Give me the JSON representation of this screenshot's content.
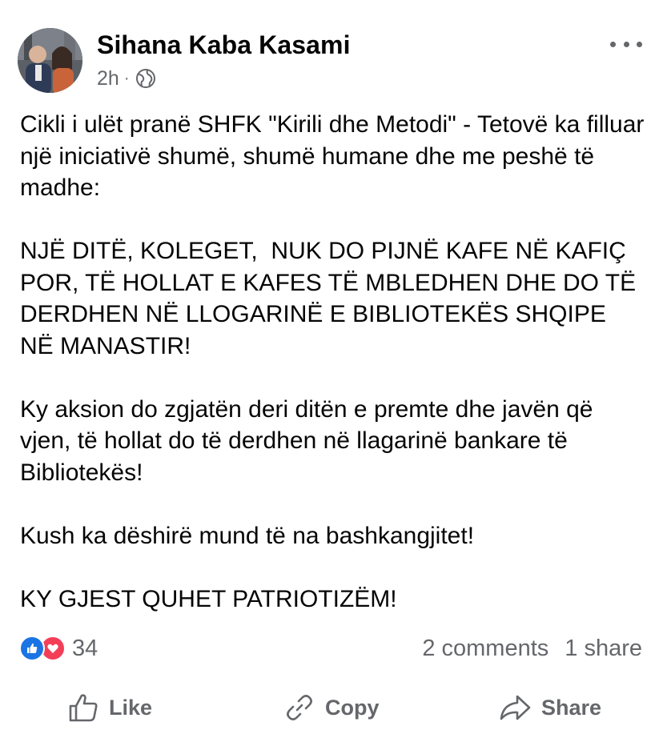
{
  "post": {
    "author": "Sihana Kaba Kasami",
    "time": "2h",
    "separator": "·",
    "privacy_icon": "globe-icon",
    "more_icon": "more-options-icon",
    "paragraphs": [
      "Cikli i ulët pranë SHFK \"Kirili dhe Metodi\" - Tetovë ka filluar një iniciativë shumë, shumë humane dhe me peshë të madhe:",
      "NJË DITË, KOLEGET,  NUK DO PIJNË KAFE NË KAFIÇ POR, TË HOLLAT E KAFES TË MBLEDHEN DHE DO TË DERDHEN NË LLOGARINË E BIBLIOTEKËS SHQIPE NË MANASTIR!",
      "Ky aksion do zgjatën deri ditën e premte dhe javën që vjen, të hollat do të derdhen në llagarinë bankare të Bibliotekës!",
      "Kush ka dëshirë mund të na bashkangjitet!",
      "KY GJEST QUHET PATRIOTIZËM!"
    ]
  },
  "reactions": {
    "icons": [
      "like-reaction-icon",
      "love-reaction-icon"
    ],
    "count": "34",
    "comments": "2 comments",
    "shares": "1 share"
  },
  "actions": {
    "like": "Like",
    "copy": "Copy",
    "share": "Share"
  },
  "colors": {
    "text": "#050505",
    "secondary": "#65676b",
    "like_blue": "#1b74e4",
    "love_red": "#f33e58"
  }
}
